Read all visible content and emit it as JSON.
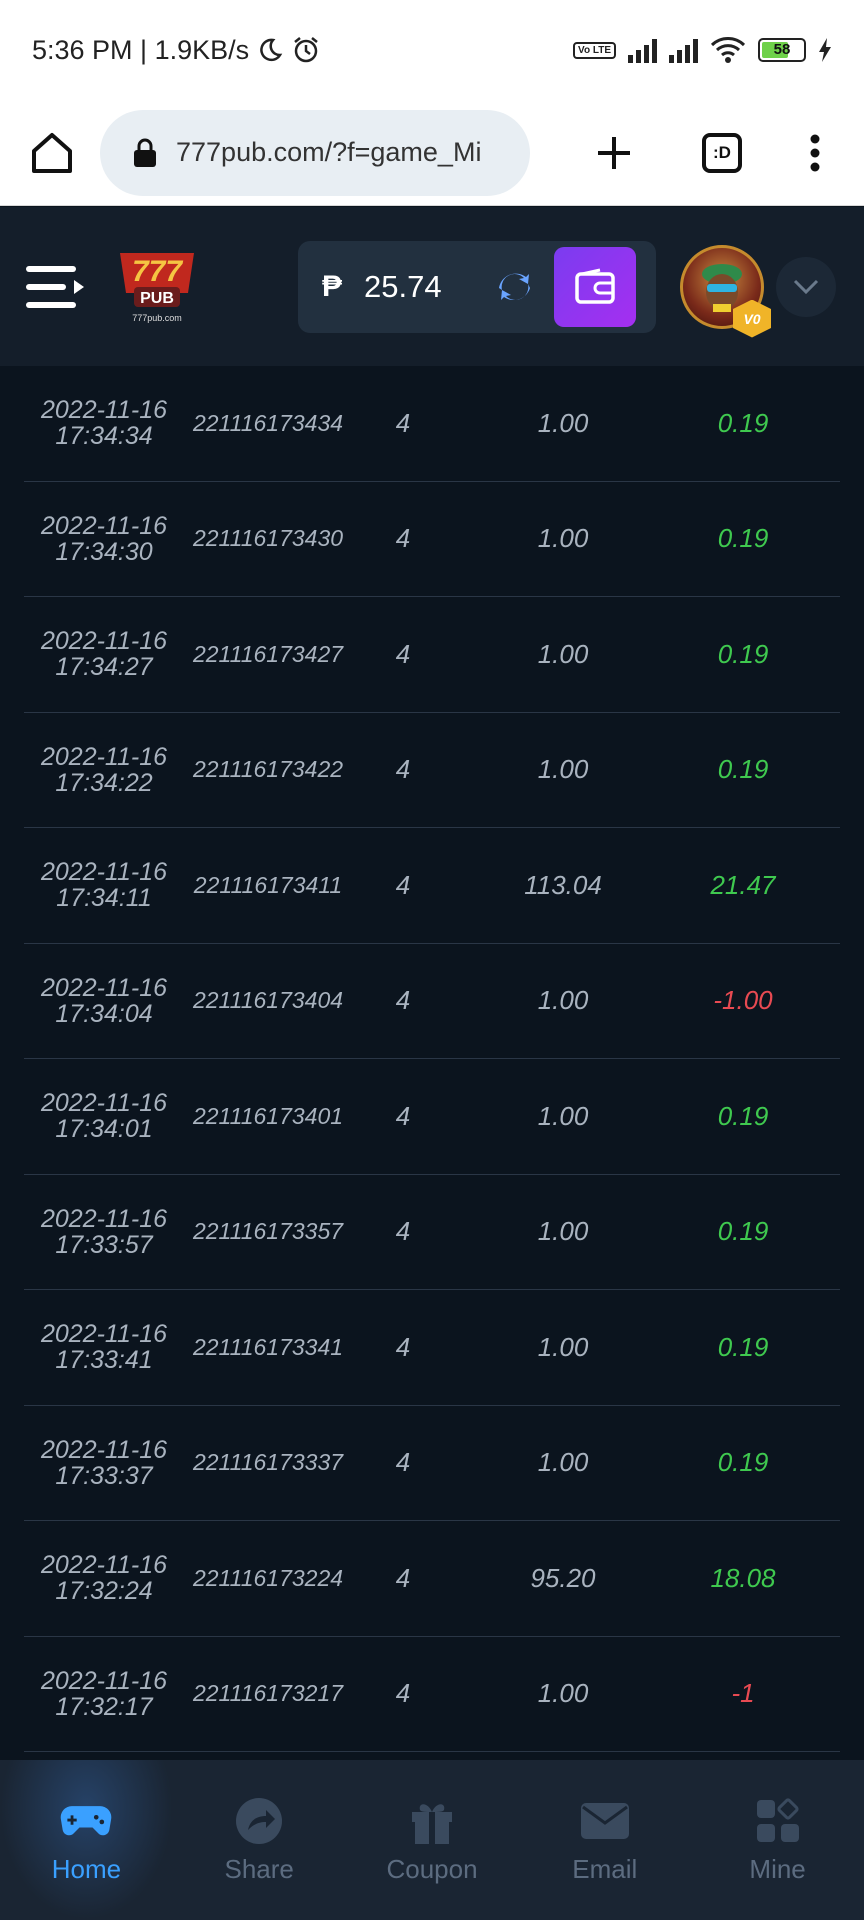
{
  "status_bar": {
    "time_speed": "5:36 PM | 1.9KB/s",
    "volte": "Vo LTE",
    "battery": "58"
  },
  "browser": {
    "url": "777pub.com/?f=game_Mi",
    "tabs_label": ":D"
  },
  "header": {
    "logo_text": "777 PUB",
    "logo_sub": "777pub.com",
    "currency": "₱",
    "balance": "25.74",
    "vip": "V0"
  },
  "records": [
    {
      "date": "2022-11-16",
      "time": "17:34:34",
      "id": "221116173434",
      "n": "4",
      "bet": "1.00",
      "win": "0.19",
      "kind": "pos"
    },
    {
      "date": "2022-11-16",
      "time": "17:34:30",
      "id": "221116173430",
      "n": "4",
      "bet": "1.00",
      "win": "0.19",
      "kind": "pos"
    },
    {
      "date": "2022-11-16",
      "time": "17:34:27",
      "id": "221116173427",
      "n": "4",
      "bet": "1.00",
      "win": "0.19",
      "kind": "pos"
    },
    {
      "date": "2022-11-16",
      "time": "17:34:22",
      "id": "221116173422",
      "n": "4",
      "bet": "1.00",
      "win": "0.19",
      "kind": "pos"
    },
    {
      "date": "2022-11-16",
      "time": "17:34:11",
      "id": "221116173411",
      "n": "4",
      "bet": "113.04",
      "win": "21.47",
      "kind": "pos"
    },
    {
      "date": "2022-11-16",
      "time": "17:34:04",
      "id": "221116173404",
      "n": "4",
      "bet": "1.00",
      "win": "-1.00",
      "kind": "neg"
    },
    {
      "date": "2022-11-16",
      "time": "17:34:01",
      "id": "221116173401",
      "n": "4",
      "bet": "1.00",
      "win": "0.19",
      "kind": "pos"
    },
    {
      "date": "2022-11-16",
      "time": "17:33:57",
      "id": "221116173357",
      "n": "4",
      "bet": "1.00",
      "win": "0.19",
      "kind": "pos"
    },
    {
      "date": "2022-11-16",
      "time": "17:33:41",
      "id": "221116173341",
      "n": "4",
      "bet": "1.00",
      "win": "0.19",
      "kind": "pos"
    },
    {
      "date": "2022-11-16",
      "time": "17:33:37",
      "id": "221116173337",
      "n": "4",
      "bet": "1.00",
      "win": "0.19",
      "kind": "pos"
    },
    {
      "date": "2022-11-16",
      "time": "17:32:24",
      "id": "221116173224",
      "n": "4",
      "bet": "95.20",
      "win": "18.08",
      "kind": "pos"
    },
    {
      "date": "2022-11-16",
      "time": "17:32:17",
      "id": "221116173217",
      "n": "4",
      "bet": "1.00",
      "win": "-1",
      "kind": "neg"
    }
  ],
  "nav": [
    {
      "label": "Home",
      "icon": "gamepad-icon"
    },
    {
      "label": "Share",
      "icon": "share-icon"
    },
    {
      "label": "Coupon",
      "icon": "gift-icon"
    },
    {
      "label": "Email",
      "icon": "mail-icon"
    },
    {
      "label": "Mine",
      "icon": "grid-icon"
    }
  ],
  "colors": {
    "positive": "#3fc94f",
    "negative": "#e84a52",
    "accent": "#3aa0ff",
    "wallet": "#8a35f0"
  }
}
